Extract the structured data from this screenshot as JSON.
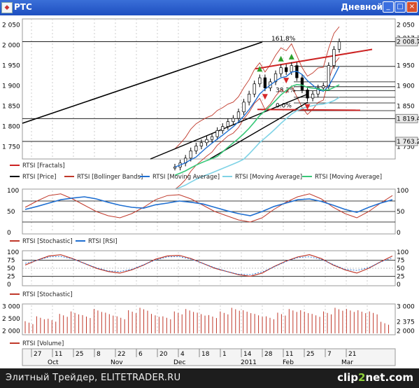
{
  "window": {
    "title": "РТС",
    "period": "Дневной",
    "minimize": "_",
    "maximize": "□",
    "close": "×"
  },
  "price_panel": {
    "y_ticks": [
      "2 050",
      "2 000",
      "1 950",
      "1 900",
      "1 850",
      "1 800",
      "1 750"
    ],
    "right_ticks": [
      "2 050",
      "1 950",
      "1 900",
      "1 850",
      "1 750"
    ],
    "fib_label": "161.8%",
    "level_labels": [
      "2 017.3",
      "2 008.72",
      "1 819.48",
      "1 763.21"
    ],
    "fib_mid_labels": [
      "38.2%",
      "0.0%"
    ],
    "ylim": [
      1720,
      2065
    ],
    "fib_lines": [
      2008.72,
      1948,
      1910,
      1898,
      1888,
      1872,
      1858,
      1839
    ]
  },
  "legend_main": [
    "RTSI [Fractals]",
    "RTSI [Price]",
    "RTSI [Bollinger Bands]",
    "RTSI [Moving Average]",
    "RTSI [Moving Average]",
    "RTSI [Moving Average]"
  ],
  "rsi_panel": {
    "ticks": [
      "100",
      "50",
      "0"
    ],
    "legend": [
      "RTSI [Stochastic]",
      "RTSI [RSI]"
    ]
  },
  "stoch_panel": {
    "ticks_left": [
      "100",
      "75",
      "50",
      "25",
      "0"
    ],
    "ticks_right": [
      "100",
      "75",
      "50",
      "25",
      "0"
    ],
    "legend": [
      "RTSI [Stochastic]"
    ]
  },
  "volume_panel": {
    "ticks": [
      "3 000",
      "2 500",
      "2 000"
    ],
    "right_ticks": [
      "3 000",
      "2 375",
      "2 000"
    ],
    "legend": [
      "RTSI [Volume]"
    ]
  },
  "x_axis": {
    "days": [
      "27",
      "11",
      "25",
      "8",
      "22",
      "6",
      "20",
      "4",
      "18",
      "1",
      "14",
      "28",
      "11",
      "25",
      "7",
      "21"
    ],
    "months": [
      "Oct",
      "Nov",
      "Dec",
      "2011",
      "Feb",
      "Mar"
    ]
  },
  "footer": {
    "site": "Элитный Трейдер, ELITETRADER.RU",
    "brand_prefix": "clip",
    "brand_num": "2",
    "brand_suffix": "net",
    "brand_tld": ".com"
  },
  "colors": {
    "titlebar": "#2458c8",
    "price": "#000000",
    "fractal_up": "#2ca02c",
    "fractal_down": "#d62728",
    "bollinger": "#c0392b",
    "ma_blue": "#1f6fd1",
    "ma_cyan": "#7fd3e6",
    "ma_green": "#38c878",
    "stoch": "#c0392b",
    "volume": "#c0392b",
    "trend_red": "#cc2222"
  },
  "chart_data": {
    "type": "line",
    "title": "РТС",
    "period": "Дневной",
    "price_ohlc_close": [
      1700,
      1710,
      1722,
      1740,
      1752,
      1760,
      1768,
      1775,
      1790,
      1800,
      1812,
      1820,
      1836,
      1860,
      1880,
      1905,
      1920,
      1895,
      1910,
      1930,
      1945,
      1935,
      1950,
      1920,
      1890,
      1870,
      1880,
      1895,
      1900,
      1950,
      1990,
      2008.72
    ],
    "rsi": [
      55,
      62,
      70,
      78,
      82,
      85,
      80,
      72,
      65,
      60,
      58,
      66,
      70,
      75,
      72,
      68,
      60,
      52,
      45,
      40,
      50,
      62,
      70,
      78,
      80,
      74,
      65,
      55,
      48,
      60,
      70,
      78
    ],
    "stochastic": [
      60,
      75,
      88,
      92,
      80,
      65,
      50,
      40,
      35,
      45,
      60,
      78,
      88,
      90,
      80,
      65,
      50,
      40,
      30,
      25,
      35,
      55,
      72,
      85,
      92,
      80,
      60,
      45,
      35,
      50,
      70,
      88
    ],
    "volume": [
      2400,
      2600,
      2500,
      2700,
      2800,
      2650,
      2900,
      2750,
      2600,
      2850,
      2950,
      2700,
      2600,
      2800,
      2900,
      2750,
      2650,
      2800,
      2950,
      2850,
      2700,
      2600,
      2750,
      2900,
      2850,
      2700,
      2800,
      2950,
      2900,
      2850,
      2800,
      2375
    ],
    "levels": [
      2008.72,
      1819.48,
      1763.21
    ],
    "fib_level_label": "161.8%"
  }
}
